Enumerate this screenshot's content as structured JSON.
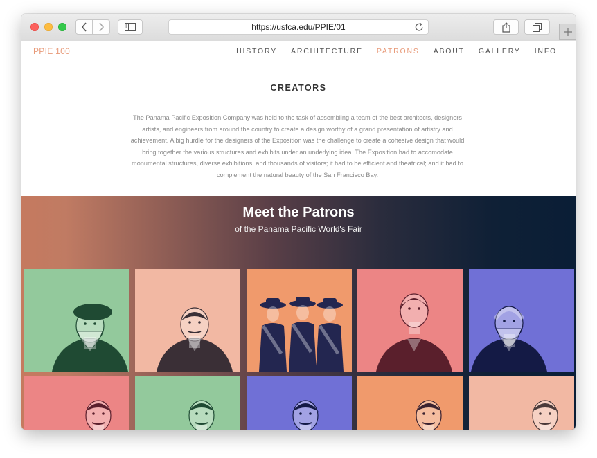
{
  "browser": {
    "url": "https://usfca.edu/PPIE/01"
  },
  "site": {
    "logo": "PPIE 100",
    "nav": [
      {
        "label": "HISTORY"
      },
      {
        "label": "ARCHITECTURE"
      },
      {
        "label": "PATRONS",
        "active": true
      },
      {
        "label": "ABOUT"
      },
      {
        "label": "GALLERY"
      },
      {
        "label": "INFO"
      }
    ]
  },
  "creators": {
    "heading": "CREATORS",
    "lines": [
      "The Panama Pacific Exposition Company was held to the task of assembling a team of the best architects, designers",
      "artists, and engineers from around the country to create a design worthy of a grand presentation of artistry and",
      "achievement. A big hurdle for the designers of the Exposition was the challenge to create a cohesive design that would",
      "bring together the various structures and exhibits under an underlying idea. The Exposition had to accomodate",
      "monumental structures, diverse exhibitions, and thousands of visitors; it had to be efficient and theatrical; and it had to",
      "complement the natural beauty of the San Francisco Bay."
    ]
  },
  "patrons": {
    "title": "Meet the Patrons",
    "subtitle": "of the Panama Pacific World's Fair",
    "tiles": [
      {
        "bg": "#93c99c",
        "fg": "#1f4a33"
      },
      {
        "bg": "#f2b8a3",
        "fg": "#3a2f36"
      },
      {
        "bg": "#f09a6c",
        "fg": "#232650"
      },
      {
        "bg": "#ec8585",
        "fg": "#5a1f2c"
      },
      {
        "bg": "#7070d6",
        "fg": "#141a45"
      },
      {
        "bg": "#ec8585",
        "fg": "#5a1f2c"
      },
      {
        "bg": "#93c99c",
        "fg": "#1f4a33"
      },
      {
        "bg": "#7070d6",
        "fg": "#141a45"
      },
      {
        "bg": "#f09a6c",
        "fg": "#3a2230"
      },
      {
        "bg": "#f2b8a3",
        "fg": "#4a3a3a"
      }
    ]
  }
}
